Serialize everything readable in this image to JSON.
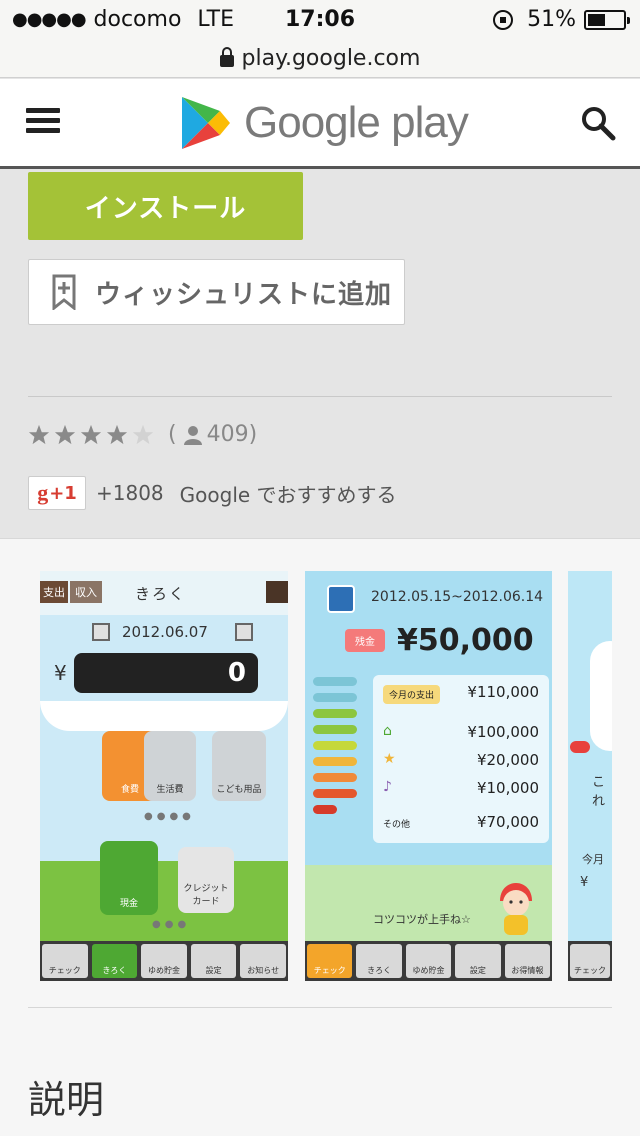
{
  "status_bar": {
    "signal_dots": "●●●●●",
    "carrier": "docomo",
    "network": "LTE",
    "time": "17:06",
    "battery_text": "51%",
    "battery_level": 0.51
  },
  "url_bar": {
    "url": "play.google.com"
  },
  "header": {
    "logo_text": "Google play",
    "menu_icon": "hamburger-icon",
    "search_icon": "search-icon"
  },
  "actions": {
    "install_label": "インストール",
    "wishlist_label": "ウィッシュリストに追加"
  },
  "rating": {
    "stars_filled": 4,
    "stars_total": 5,
    "open_paren": "(",
    "count": "409",
    "close_paren": ")"
  },
  "gplus": {
    "badge_g": "g",
    "badge_plus": "+1",
    "count": "+1808",
    "text": "Google でおすすめする"
  },
  "screenshots": {
    "shot1": {
      "tab_expense": "支出",
      "tab_income": "収入",
      "title": "きろく",
      "date": "2012.06.07",
      "yen": "¥",
      "amount": "0",
      "categories": [
        "食費",
        "生活費",
        "こども用品"
      ],
      "payment_cash": "現金",
      "payment_credit": "クレジット\nカード",
      "tabs": [
        "チェック",
        "きろく",
        "ゆめ貯金",
        "設定",
        "お知らせ"
      ]
    },
    "shot2": {
      "date_range": "2012.05.15~2012.06.14",
      "balance_label": "残金",
      "balance": "¥50,000",
      "month_expense_label": "今月の支出",
      "month_expense": "¥110,000",
      "row_values": [
        "¥100,000",
        "¥20,000",
        "¥10,000"
      ],
      "other_label": "その他",
      "other_value": "¥70,000",
      "caption": "コツコツが上手ね☆",
      "tabs": [
        "チェック",
        "きろく",
        "ゆめ貯金",
        "設定",
        "お得情報"
      ]
    },
    "shot3": {
      "partial_text": "これ",
      "partial_text2": "今月",
      "tab": "チェック"
    }
  },
  "description": {
    "title": "説明"
  },
  "colors": {
    "install_green": "#a4c237",
    "gplus_red": "#d73d32",
    "page_gray": "#e5e5e5"
  }
}
